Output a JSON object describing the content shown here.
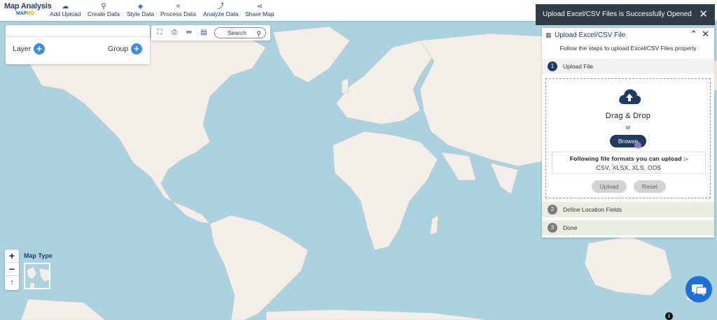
{
  "brand": {
    "title": "Map Analysis",
    "sub_prefix": "MAP",
    "sub_accent": "RO"
  },
  "toolbar": {
    "items": [
      {
        "label": "Add Upload",
        "icon": "cloud-upload-icon"
      },
      {
        "label": "Create Data",
        "icon": "map-pin-icon"
      },
      {
        "label": "Style Data",
        "icon": "paint-bucket-icon"
      },
      {
        "label": "Process Data",
        "icon": "process-nodes-icon"
      },
      {
        "label": "Analyze Data",
        "icon": "analyze-chart-icon"
      },
      {
        "label": "Share Map",
        "icon": "share-icon"
      }
    ]
  },
  "layer_panel": {
    "layer_label": "Layer",
    "group_label": "Group"
  },
  "map_tools": {
    "search_label": "Search"
  },
  "toast": {
    "message": "Upload Excel/CSV Files is Successfully Opened"
  },
  "upload_panel": {
    "title": "Upload Excel/CSV File",
    "subtitle": "Follow the steps to upload Excel/CSV Files properly",
    "steps": [
      {
        "num": "1",
        "label": "Upload File"
      },
      {
        "num": "2",
        "label": "Define Location Fields"
      },
      {
        "num": "3",
        "label": "Done"
      }
    ],
    "dropzone": {
      "title": "Drag & Drop",
      "or": "or",
      "browse": "Browse",
      "formats_title": "Following file formats you can upload :-",
      "formats_list": "CSV, XLSX, XLS, ODS",
      "upload_btn": "Upload",
      "reset_btn": "Reset"
    }
  },
  "map_controls": {
    "zoom_in": "+",
    "zoom_out": "−",
    "reset": "↑",
    "map_type_label": "Map Type"
  },
  "info": "i",
  "colors": {
    "navy": "#1f3b64",
    "accent": "#3d8ee6",
    "ocean": "#aad3df",
    "land": "#f2efe9"
  }
}
